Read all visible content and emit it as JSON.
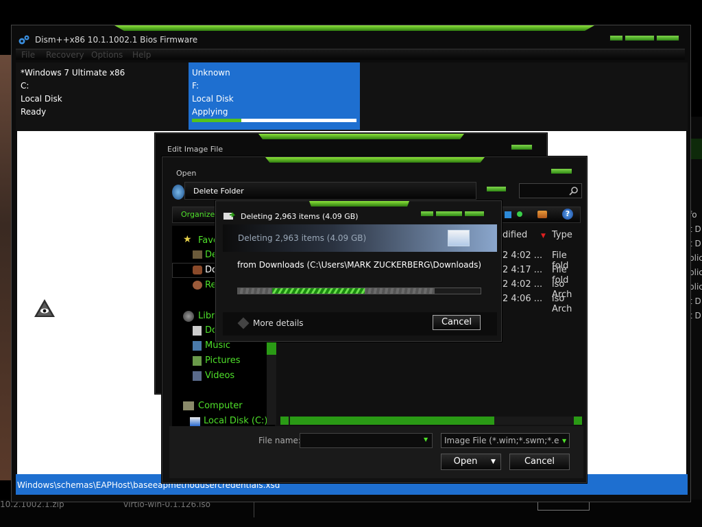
{
  "main_window": {
    "title": "Dism++x86 10.1.1002.1 Bios Firmware",
    "menu": [
      "File",
      "Recovery",
      "Options",
      "Help"
    ],
    "session_left": {
      "name": "*Windows 7 Ultimate x86",
      "drive": "C:",
      "disk": "Local Disk",
      "status": "Ready"
    },
    "session_right": {
      "name": "Unknown",
      "drive": "F:",
      "disk": "Local Disk",
      "status": "Applying",
      "progress": 0.3
    },
    "status_path": "Windows\\schemas\\EAPHost\\baseeapmethodusercredentials.xsd"
  },
  "bg_window": {
    "right_texts": [
      "fo",
      "t D",
      "t D",
      "plic",
      "plic",
      "plic",
      "t D",
      "t D"
    ],
    "bottom_left_text": "10.2.1002.1.zip",
    "bottom_mid_text": "virtio-win-0.1.126.iso"
  },
  "edit_image": {
    "title": "Edit Image File"
  },
  "open_dialog": {
    "title": "Open",
    "breadcrumb": "Delete Folder",
    "organize_label": "Organize",
    "columns": {
      "modified": "dified",
      "type": "Type"
    },
    "rows": [
      {
        "date": "2 4:02 ...",
        "type": "File fold"
      },
      {
        "date": "2 4:17 ...",
        "type": "File fold"
      },
      {
        "date": "2 4:02 ...",
        "type": "iso Arch"
      },
      {
        "date": "2 4:06 ...",
        "type": "iso Arch"
      }
    ],
    "nav": {
      "favorites": "Favo",
      "fav_items": [
        "De",
        "Do",
        "Re"
      ],
      "libraries": "Libra",
      "lib_items": [
        "Do",
        "Music",
        "Pictures",
        "Videos"
      ],
      "computer": "Computer",
      "computer_items": [
        "Local Disk (C:)"
      ]
    },
    "filename_label": "File name:",
    "filename_value": "",
    "filter": "Image File (*.wim;*.swm;*.esd;*",
    "open_label": "Open",
    "cancel_label": "Cancel"
  },
  "delete_dialog": {
    "title": "Deleting 2,963 items (4.09 GB)",
    "header": "Deleting 2,963 items (4.09 GB)",
    "from": "from Downloads (C:\\Users\\MARK ZUCKERBERG\\Downloads)",
    "progress": 0.81,
    "more_details": "More details",
    "cancel_label": "Cancel"
  },
  "colors": {
    "accent_blue": "#1e6fd0",
    "green": "#4fe02a",
    "panel": "#0c0c0c"
  }
}
